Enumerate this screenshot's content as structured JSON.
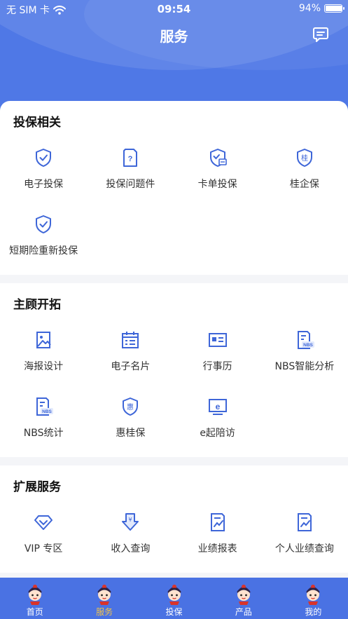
{
  "status_bar": {
    "carrier": "无 SIM 卡",
    "time": "09:54",
    "battery": "94%",
    "battery_level": 0.94
  },
  "page": {
    "title": "服务"
  },
  "sections": [
    {
      "title": "投保相关",
      "items": [
        {
          "label": "电子投保",
          "icon": "shield-check-icon"
        },
        {
          "label": "投保问题件",
          "icon": "document-question-icon"
        },
        {
          "label": "卡单投保",
          "icon": "shield-card-icon"
        },
        {
          "label": "桂企保",
          "icon": "shield-gui-icon"
        },
        {
          "label": "短期险重新投保",
          "icon": "shield-check-icon"
        }
      ]
    },
    {
      "title": "主顾开拓",
      "items": [
        {
          "label": "海报设计",
          "icon": "poster-icon"
        },
        {
          "label": "电子名片",
          "icon": "calendar-card-icon"
        },
        {
          "label": "行事历",
          "icon": "id-card-icon"
        },
        {
          "label": "NBS智能分析",
          "icon": "nbs-report-icon"
        },
        {
          "label": "NBS统计",
          "icon": "nbs-stats-icon"
        },
        {
          "label": "惠桂保",
          "icon": "shield-hui-icon"
        },
        {
          "label": "e起陪访",
          "icon": "e-monitor-icon"
        }
      ]
    },
    {
      "title": "扩展服务",
      "items": [
        {
          "label": "VIP 专区",
          "icon": "diamond-icon"
        },
        {
          "label": "收入查询",
          "icon": "income-icon"
        },
        {
          "label": "业绩报表",
          "icon": "report-icon"
        },
        {
          "label": "个人业绩查询",
          "icon": "personal-report-icon"
        }
      ]
    }
  ],
  "tabbar": [
    {
      "label": "首页",
      "active": false
    },
    {
      "label": "服务",
      "active": true
    },
    {
      "label": "投保",
      "active": false
    },
    {
      "label": "产品",
      "active": false
    },
    {
      "label": "我的",
      "active": false
    }
  ],
  "colors": {
    "primary": "#4f78e6",
    "tabbar": "#4a72e3",
    "active_tab": "#f1c24a",
    "icon_stroke": "#3e66d8"
  }
}
